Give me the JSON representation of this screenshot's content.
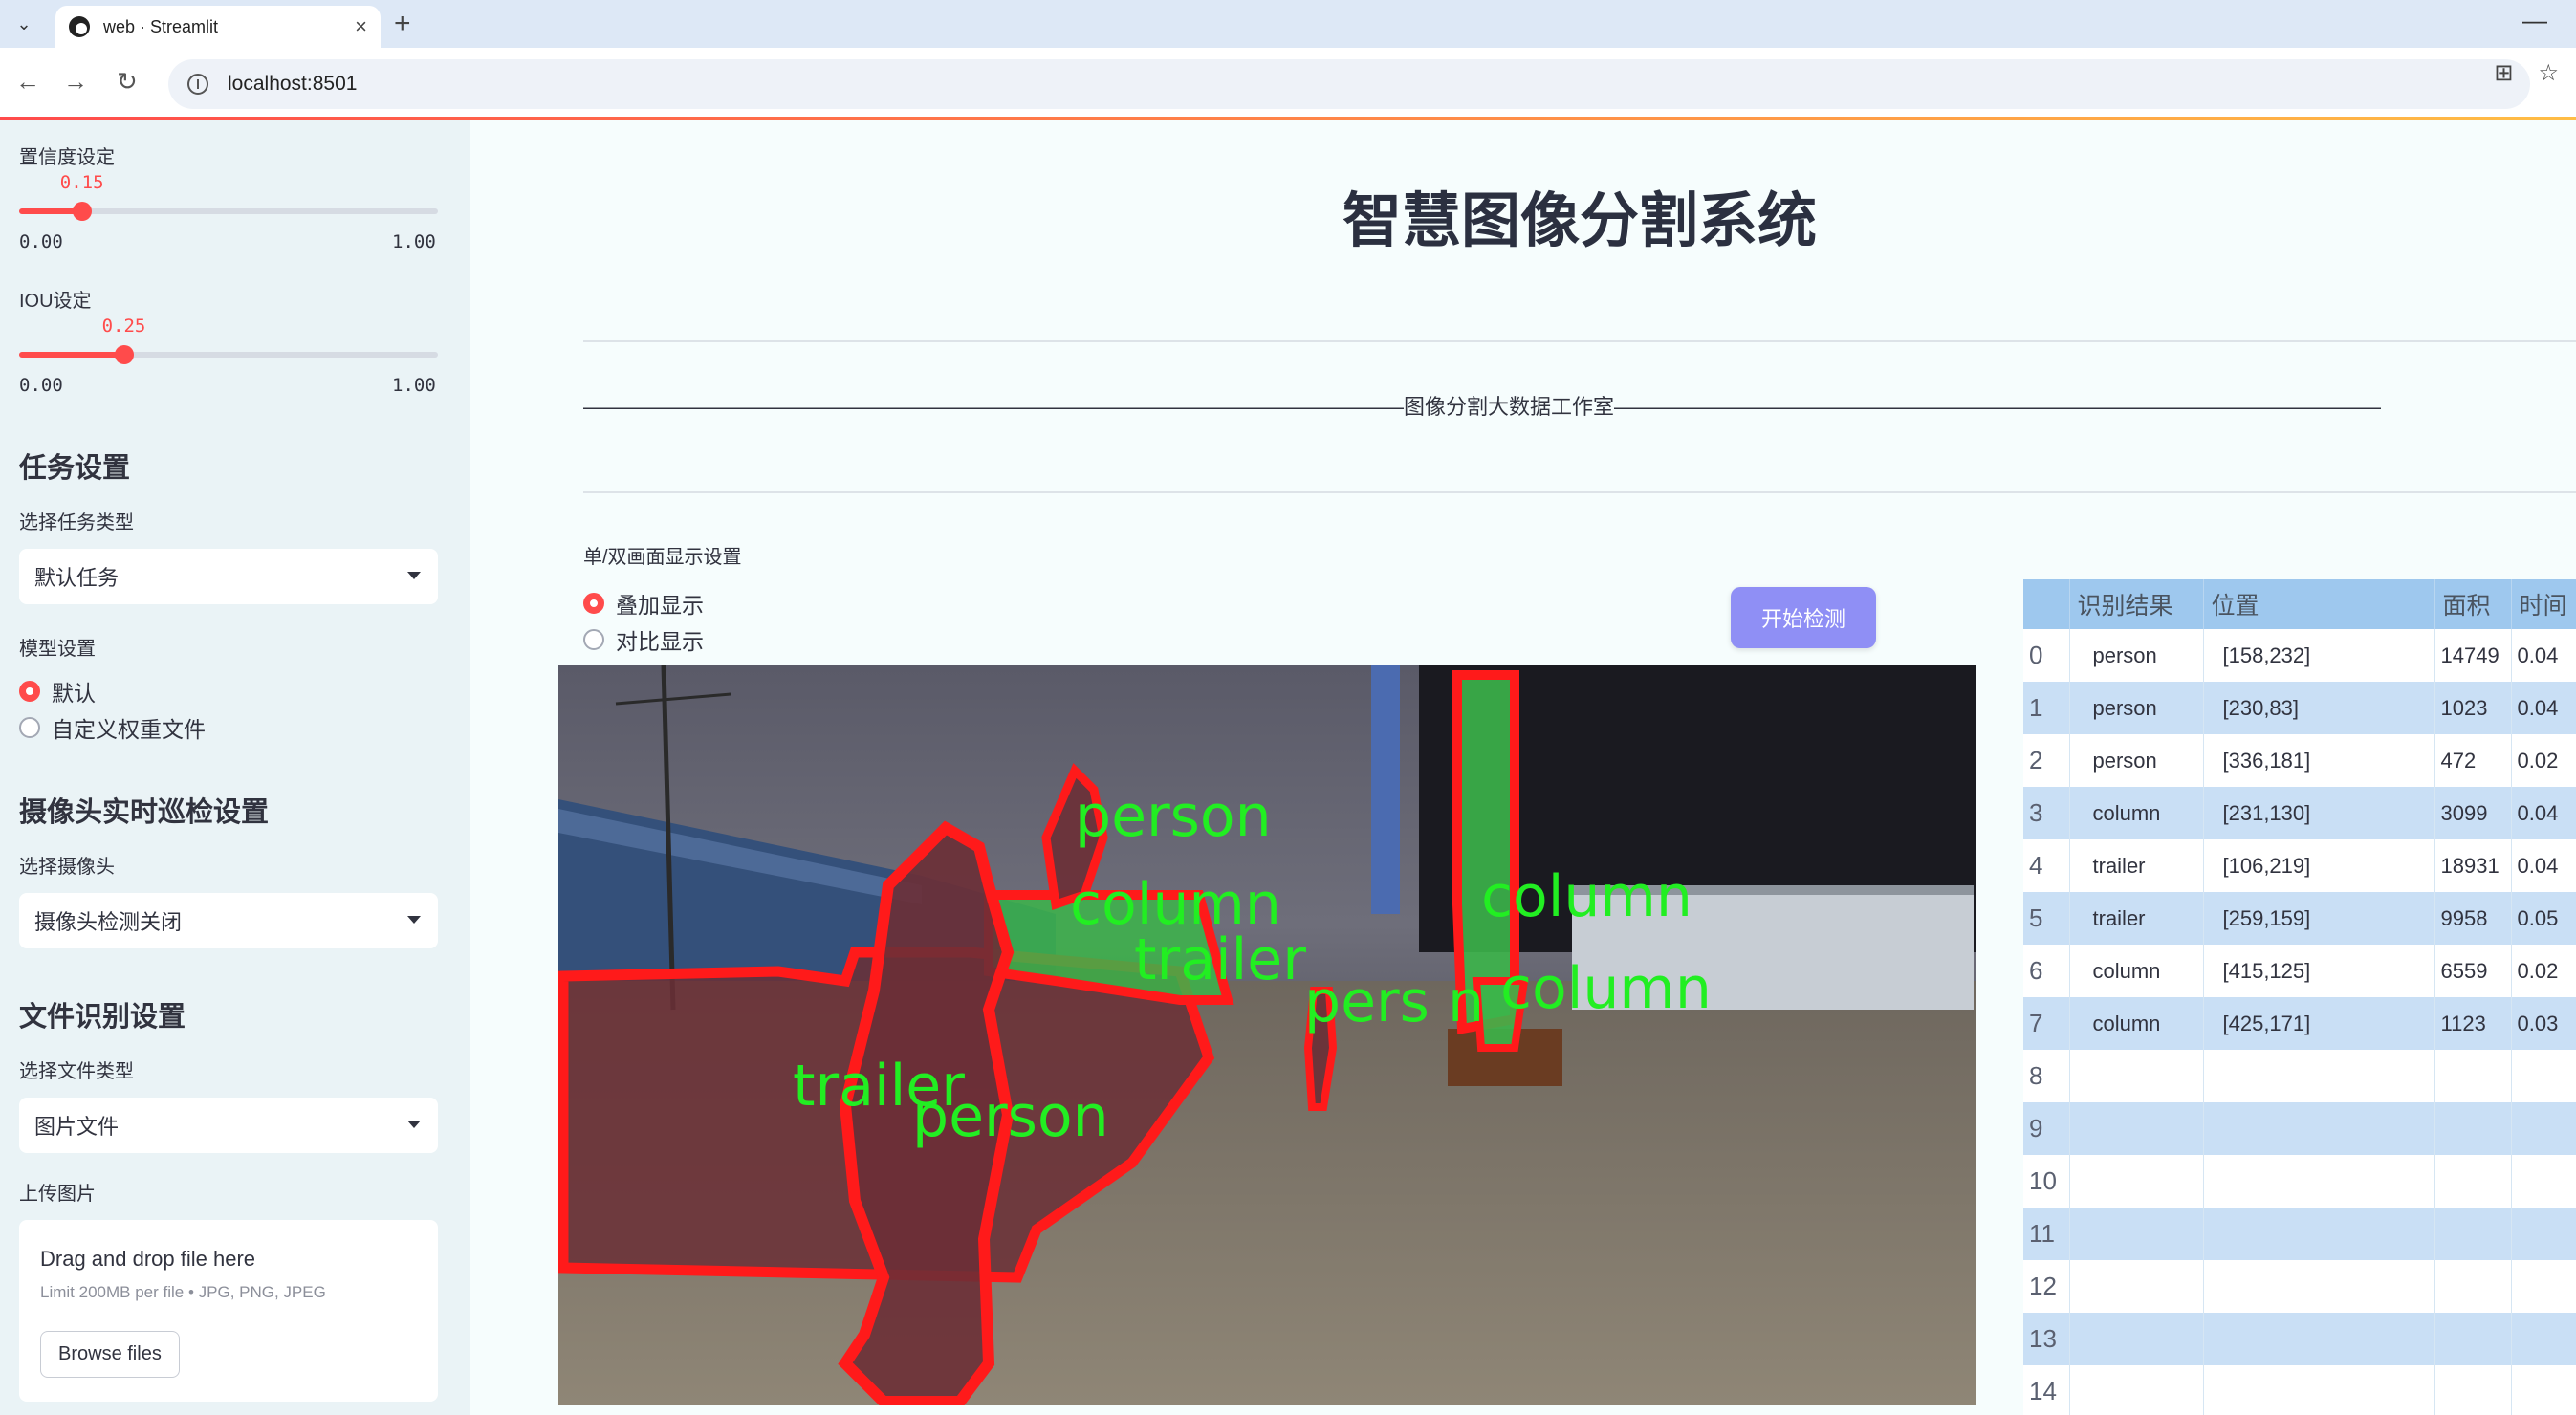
{
  "browser": {
    "tab_title": "web · Streamlit",
    "url": "localhost:8501"
  },
  "sidebar": {
    "confidence": {
      "label": "置信度设定",
      "value": "0.15",
      "value_num": 0.15,
      "min": "0.00",
      "max": "1.00"
    },
    "iou": {
      "label": "IOU设定",
      "value": "0.25",
      "value_num": 0.25,
      "min": "0.00",
      "max": "1.00"
    },
    "task_section": {
      "heading": "任务设置",
      "task_type_label": "选择任务类型",
      "task_type_value": "默认任务",
      "model_label": "模型设置",
      "model_options": [
        "默认",
        "自定义权重文件"
      ],
      "model_selected": 0
    },
    "camera_section": {
      "heading": "摄像头实时巡检设置",
      "camera_label": "选择摄像头",
      "camera_value": "摄像头检测关闭"
    },
    "file_section": {
      "heading": "文件识别设置",
      "file_type_label": "选择文件类型",
      "file_type_value": "图片文件",
      "upload_label": "上传图片",
      "dropzone_title": "Drag and drop file here",
      "dropzone_limit": "Limit 200MB per file • JPG, PNG, JPEG",
      "browse_button": "Browse files"
    }
  },
  "main": {
    "title": "智慧图像分割系统",
    "banner": "———————————————————————————————————————图像分割大数据工作室———————————————————————————————————————",
    "display_label": "单/双画面显示设置",
    "display_options": [
      "叠加显示",
      "对比显示"
    ],
    "display_selected": 0,
    "start_button": "开始检测"
  },
  "image_labels": {
    "person_1": "person",
    "person_2": "person",
    "person_3": "pers n",
    "column_1": "column",
    "column_2": "column",
    "column_3": "column",
    "trailer_1": "trailer",
    "trailer_2": "trailer"
  },
  "results_table": {
    "columns": [
      "",
      "识别结果",
      "位置",
      "面积",
      "时间"
    ],
    "rows": [
      {
        "idx": "0",
        "cls": "person",
        "pos": "[158,232]",
        "area": "14749",
        "time": "0.04"
      },
      {
        "idx": "1",
        "cls": "person",
        "pos": "[230,83]",
        "area": "1023",
        "time": "0.04"
      },
      {
        "idx": "2",
        "cls": "person",
        "pos": "[336,181]",
        "area": "472",
        "time": "0.02"
      },
      {
        "idx": "3",
        "cls": "column",
        "pos": "[231,130]",
        "area": "3099",
        "time": "0.04"
      },
      {
        "idx": "4",
        "cls": "trailer",
        "pos": "[106,219]",
        "area": "18931",
        "time": "0.04"
      },
      {
        "idx": "5",
        "cls": "trailer",
        "pos": "[259,159]",
        "area": "9958",
        "time": "0.05"
      },
      {
        "idx": "6",
        "cls": "column",
        "pos": "[415,125]",
        "area": "6559",
        "time": "0.02"
      },
      {
        "idx": "7",
        "cls": "column",
        "pos": "[425,171]",
        "area": "1123",
        "time": "0.03"
      },
      {
        "idx": "8",
        "cls": "",
        "pos": "",
        "area": "",
        "time": ""
      },
      {
        "idx": "9",
        "cls": "",
        "pos": "",
        "area": "",
        "time": ""
      },
      {
        "idx": "10",
        "cls": "",
        "pos": "",
        "area": "",
        "time": ""
      },
      {
        "idx": "11",
        "cls": "",
        "pos": "",
        "area": "",
        "time": ""
      },
      {
        "idx": "12",
        "cls": "",
        "pos": "",
        "area": "",
        "time": ""
      },
      {
        "idx": "13",
        "cls": "",
        "pos": "",
        "area": "",
        "time": ""
      },
      {
        "idx": "14",
        "cls": "",
        "pos": "",
        "area": "",
        "time": ""
      }
    ]
  },
  "colors": {
    "accent": "#ff4b4b",
    "sidebar_bg": "#eaf3f6",
    "main_bg": "#f6fdfd",
    "button_bg": "#8f8ff5",
    "table_header": "#9ec8ee",
    "table_stripe": "#c9dff5",
    "mask_outline": "#ff1a1a",
    "label_green": "#22ee22"
  }
}
